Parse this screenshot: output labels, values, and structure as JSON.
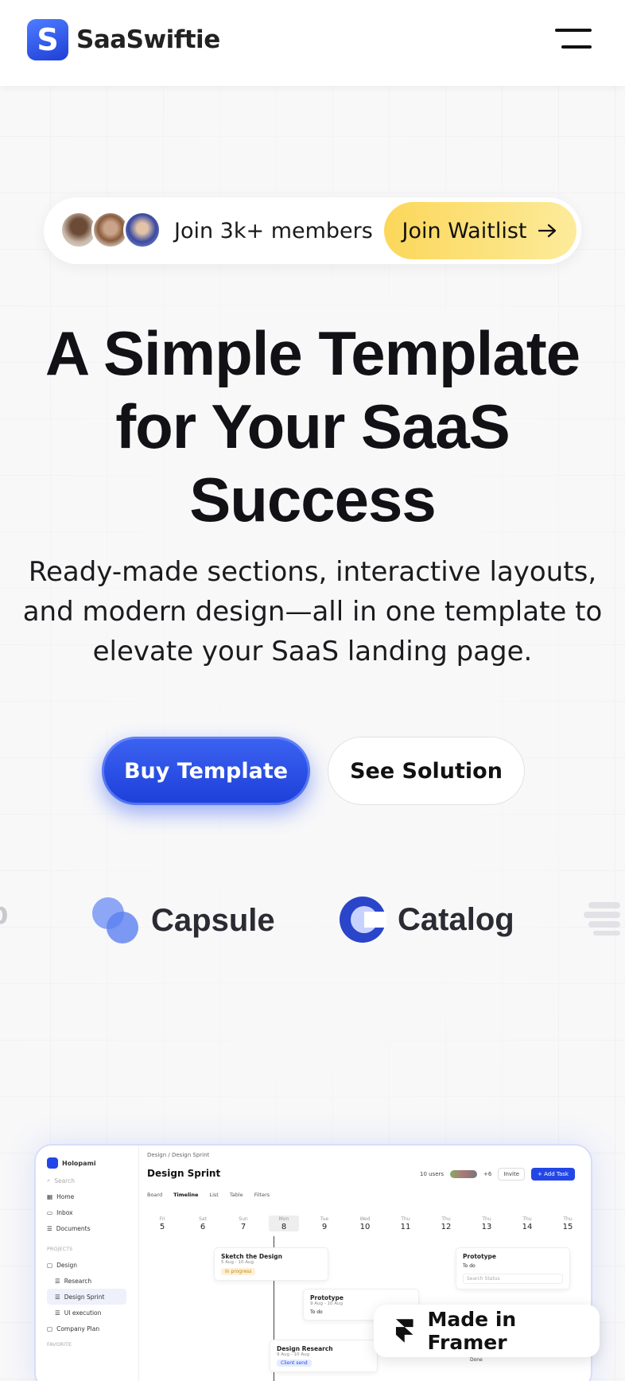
{
  "header": {
    "logo_letter": "S",
    "brand": "SaaSwiftie",
    "menu_icon": "hamburger-menu-icon"
  },
  "hero": {
    "members_text": "Join 3k+ members",
    "waitlist_label": "Join Waitlist",
    "title_line1": "A Simple Template",
    "title_line2": "for Your SaaS",
    "title_line3": "Success",
    "subtitle": "Ready-made sections, interactive layouts, and modern design—all in one template to elevate your SaaS landing page.",
    "buy_label": "Buy Template",
    "solution_label": "See Solution"
  },
  "logos": {
    "left_partial": "p",
    "brand1": "Capsule",
    "brand2": "Catalog"
  },
  "mockup": {
    "workspace": "Holopami",
    "search": "Search",
    "nav": [
      "Home",
      "Inbox",
      "Documents"
    ],
    "projects_label": "PROJECTS",
    "projects": [
      "Design",
      "Research",
      "Design Sprint",
      "UI execution",
      "Company Plan"
    ],
    "favorite_label": "FAVORITE",
    "breadcrumb": "Design  /  Design Sprint",
    "page_title": "Design Sprint",
    "users": "10 users",
    "extra_users": "+6",
    "invite": "Invite",
    "add_task": "+ Add Task",
    "views": [
      "Board",
      "Timeline",
      "List",
      "Table",
      "Filters"
    ],
    "days": [
      {
        "d": "Fri",
        "n": "5"
      },
      {
        "d": "Sat",
        "n": "6"
      },
      {
        "d": "Sun",
        "n": "7"
      },
      {
        "d": "Mon",
        "n": "8"
      },
      {
        "d": "Tue",
        "n": "9"
      },
      {
        "d": "Wed",
        "n": "10"
      },
      {
        "d": "Thu",
        "n": "11"
      },
      {
        "d": "Thu",
        "n": "12"
      },
      {
        "d": "Thu",
        "n": "13"
      },
      {
        "d": "Thu",
        "n": "14"
      },
      {
        "d": "Thu",
        "n": "15"
      }
    ],
    "card1_title": "Sketch the Design",
    "card1_dates": "5 Aug - 10 Aug",
    "card1_status": "In progress",
    "card2_title": "Prototype",
    "card2_dates": "9 Aug - 10 Aug",
    "card2_status": "To do",
    "card3_title": "Prototype",
    "card3_status": "To do",
    "card3_search": "Search Status",
    "card4_title": "Design Research",
    "card4_dates": "9 Aug - 10 Aug",
    "card4_status": "Client send",
    "card5_status": "Done"
  },
  "framer_badge": "Made in Framer",
  "colors": {
    "primary": "#2347e6",
    "accent_yellow": "#fbd75a"
  }
}
